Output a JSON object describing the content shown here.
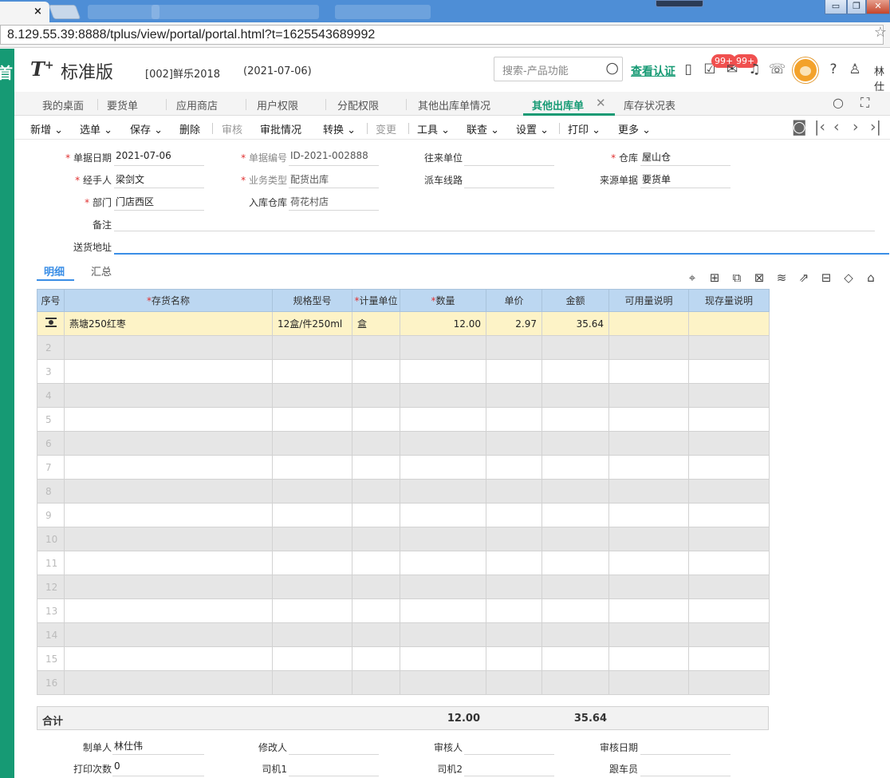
{
  "browser": {
    "tab_close": "×",
    "url": "8.129.55.39:8888/tplus/view/portal/portal.html?t=1625543689992"
  },
  "app": {
    "left_char": "首",
    "logo": "T",
    "logo_plus": "+",
    "product": "标准版",
    "company": "[002]鲜乐2018",
    "date": "(2021-07-06)",
    "search_placeholder": "搜索-产品功能",
    "verify_link": "查看认证",
    "badge1": "99+",
    "badge2": "99+",
    "username": "林仕"
  },
  "page_tabs": [
    {
      "label": "我的桌面"
    },
    {
      "label": "要货单"
    },
    {
      "label": "应用商店"
    },
    {
      "label": "用户权限"
    },
    {
      "label": "分配权限"
    },
    {
      "label": "其他出库单情况"
    },
    {
      "label": "其他出库单"
    },
    {
      "label": "库存状况表"
    }
  ],
  "toolbar": {
    "new": "新增",
    "select": "选单",
    "save": "保存",
    "delete": "删除",
    "audit": "审核",
    "approval": "审批情况",
    "convert": "转换",
    "change": "变更",
    "tools": "工具",
    "link": "联查",
    "settings": "设置",
    "print": "打印",
    "more": "更多"
  },
  "form": {
    "doc_date_label": "单据日期",
    "doc_date": "2021-07-06",
    "doc_no_label": "单据编号",
    "doc_no": "ID-2021-002888",
    "partner_label": "往来单位",
    "partner": "",
    "warehouse_label": "仓库",
    "warehouse": "屋山仓",
    "handler_label": "经手人",
    "handler": "梁剑文",
    "biz_type_label": "业务类型",
    "biz_type": "配货出库",
    "route_label": "派车线路",
    "route": "",
    "source_label": "来源单据",
    "source": "要货单",
    "dept_label": "部门",
    "dept": "门店西区",
    "in_wh_label": "入库仓库",
    "in_wh": "荷花村店",
    "remark_label": "备注",
    "remark": "",
    "address_label": "送货地址",
    "address": ""
  },
  "detail_tabs": {
    "detail": "明细",
    "summary": "汇总"
  },
  "grid": {
    "headers": [
      "序号",
      "存货名称",
      "规格型号",
      "计量单位",
      "数量",
      "单价",
      "金额",
      "可用量说明",
      "现存量说明"
    ],
    "required": [
      false,
      true,
      false,
      true,
      true,
      false,
      false,
      false,
      false
    ],
    "rows": [
      {
        "no": "",
        "name": "燕塘250红枣",
        "spec": "12盒/件250ml",
        "unit": "盒",
        "qty": "12.00",
        "price": "2.97",
        "amount": "35.64",
        "avail": "",
        "stock": ""
      },
      {
        "no": "2"
      },
      {
        "no": "3"
      },
      {
        "no": "4"
      },
      {
        "no": "5"
      },
      {
        "no": "6"
      },
      {
        "no": "7"
      },
      {
        "no": "8"
      },
      {
        "no": "9"
      },
      {
        "no": "10"
      },
      {
        "no": "11"
      },
      {
        "no": "12"
      },
      {
        "no": "13"
      },
      {
        "no": "14"
      },
      {
        "no": "15"
      },
      {
        "no": "16"
      }
    ]
  },
  "total": {
    "label": "合计",
    "qty": "12.00",
    "amount": "35.64"
  },
  "footer": {
    "maker_label": "制单人",
    "maker": "林仕伟",
    "modifier_label": "修改人",
    "modifier": "",
    "auditor_label": "审核人",
    "auditor": "",
    "audit_date_label": "审核日期",
    "audit_date": "",
    "print_count_label": "打印次数",
    "print_count": "0",
    "driver1_label": "司机1",
    "driver1": "",
    "driver2_label": "司机2",
    "driver2": "",
    "escort_label": "跟车员",
    "escort": ""
  }
}
